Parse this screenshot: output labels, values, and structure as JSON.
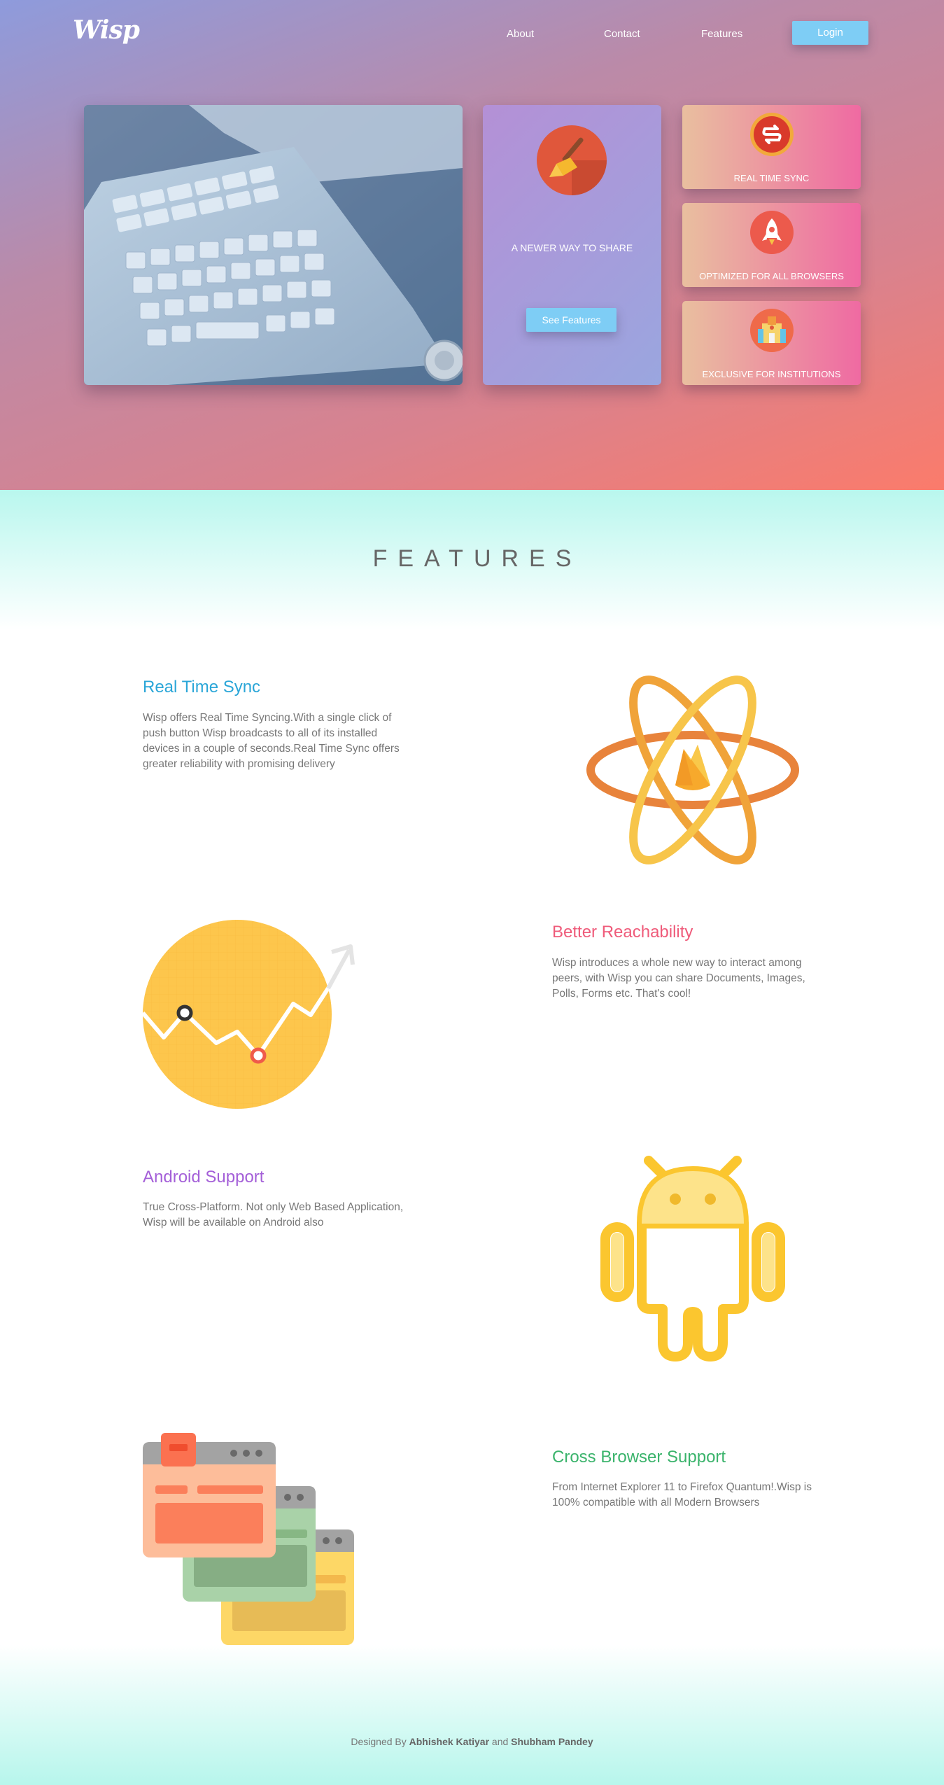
{
  "header": {
    "logo": "Wisp",
    "nav": {
      "about": "About",
      "contact": "Contact",
      "features": "Features"
    },
    "login_label": "Login"
  },
  "hero": {
    "share_text": "A NEWER WAY TO SHARE",
    "see_features_label": "See Features",
    "cards": [
      {
        "label": "REAL TIME SYNC",
        "icon": "sync-icon"
      },
      {
        "label": "OPTIMIZED FOR ALL BROWSERS",
        "icon": "rocket-icon"
      },
      {
        "label": "EXCLUSIVE FOR INSTITUTIONS",
        "icon": "institution-icon"
      }
    ]
  },
  "features": {
    "heading": "FEATURES",
    "items": [
      {
        "title": "Real Time Sync",
        "color": "#2aa6d8",
        "desc": "Wisp offers Real Time Syncing.With a single click of push button Wisp broadcasts to all of its installed devices in a couple of seconds.Real Time Sync offers greater reliability with promising delivery",
        "icon": "atom-firebase-icon"
      },
      {
        "title": "Better Reachability",
        "color": "#ef5b7a",
        "desc": "Wisp introduces a whole new way to interact among peers, with Wisp you can share Documents, Images, Polls, Forms etc. That's cool!",
        "icon": "growth-chart-icon"
      },
      {
        "title": "Android Support",
        "color": "#a45fd8",
        "desc": "True Cross-Platform. Not only Web Based Application, Wisp will be available on Android also",
        "icon": "android-icon"
      },
      {
        "title": "Cross Browser Support",
        "color": "#3ab36b",
        "desc": "From Internet Explorer 11 to Firefox Quantum!.Wisp is 100% compatible with all Modern Browsers",
        "icon": "browser-windows-icon"
      }
    ]
  },
  "footer": {
    "prefix": "Designed By",
    "author1": "Abhishek Katiyar",
    "conj": "and",
    "author2": "Shubham Pandey"
  }
}
